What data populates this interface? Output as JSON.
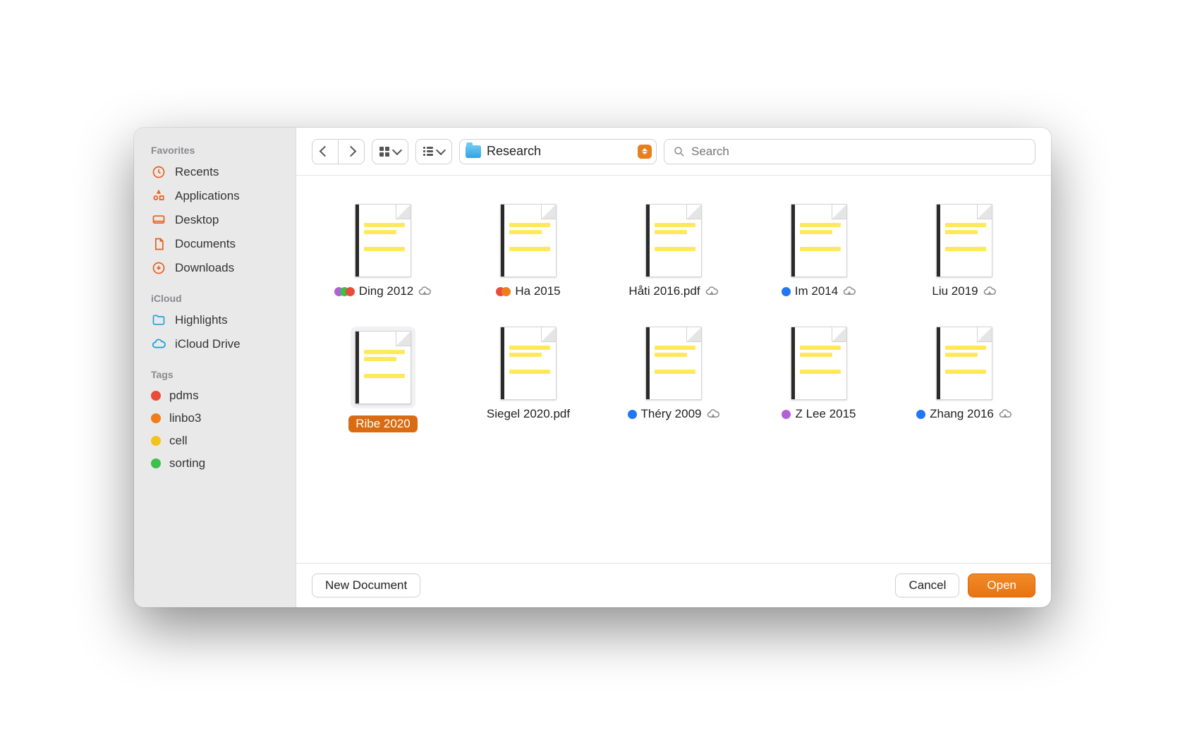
{
  "toolbar": {
    "current_folder": "Research",
    "search_placeholder": "Search"
  },
  "sidebar": {
    "sections": [
      {
        "title": "Favorites",
        "items": [
          {
            "icon": "clock-icon",
            "label": "Recents"
          },
          {
            "icon": "apps-icon",
            "label": "Applications"
          },
          {
            "icon": "desktop-icon",
            "label": "Desktop"
          },
          {
            "icon": "document-icon",
            "label": "Documents"
          },
          {
            "icon": "downloads-icon",
            "label": "Downloads"
          }
        ]
      },
      {
        "title": "iCloud",
        "items": [
          {
            "icon": "folder-blue-icon",
            "label": "Highlights"
          },
          {
            "icon": "cloud-blue-icon",
            "label": "iCloud Drive"
          }
        ]
      },
      {
        "title": "Tags",
        "items": [
          {
            "color": "red",
            "label": "pdms"
          },
          {
            "color": "orange",
            "label": "linbo3"
          },
          {
            "color": "yellow",
            "label": "cell"
          },
          {
            "color": "green",
            "label": "sorting"
          }
        ]
      }
    ]
  },
  "files": [
    {
      "name": "Ding 2012",
      "tags": [
        "purple",
        "green",
        "red"
      ],
      "cloud": true,
      "selected": false
    },
    {
      "name": "Ha 2015",
      "tags": [
        "red",
        "orange"
      ],
      "cloud": false,
      "selected": false
    },
    {
      "name": "Håti 2016.pdf",
      "tags": [],
      "cloud": true,
      "selected": false
    },
    {
      "name": "Im 2014",
      "tags": [
        "blue"
      ],
      "cloud": true,
      "selected": false
    },
    {
      "name": "Liu 2019",
      "tags": [],
      "cloud": true,
      "selected": false
    },
    {
      "name": "Ribe 2020",
      "tags": [],
      "cloud": false,
      "selected": true
    },
    {
      "name": "Siegel 2020.pdf",
      "tags": [],
      "cloud": false,
      "selected": false
    },
    {
      "name": "Théry 2009",
      "tags": [
        "blue"
      ],
      "cloud": true,
      "selected": false
    },
    {
      "name": "Z Lee 2015",
      "tags": [
        "purple"
      ],
      "cloud": false,
      "selected": false
    },
    {
      "name": "Zhang 2016",
      "tags": [
        "blue"
      ],
      "cloud": true,
      "selected": false
    }
  ],
  "footer": {
    "new_document": "New Document",
    "cancel": "Cancel",
    "open": "Open"
  }
}
